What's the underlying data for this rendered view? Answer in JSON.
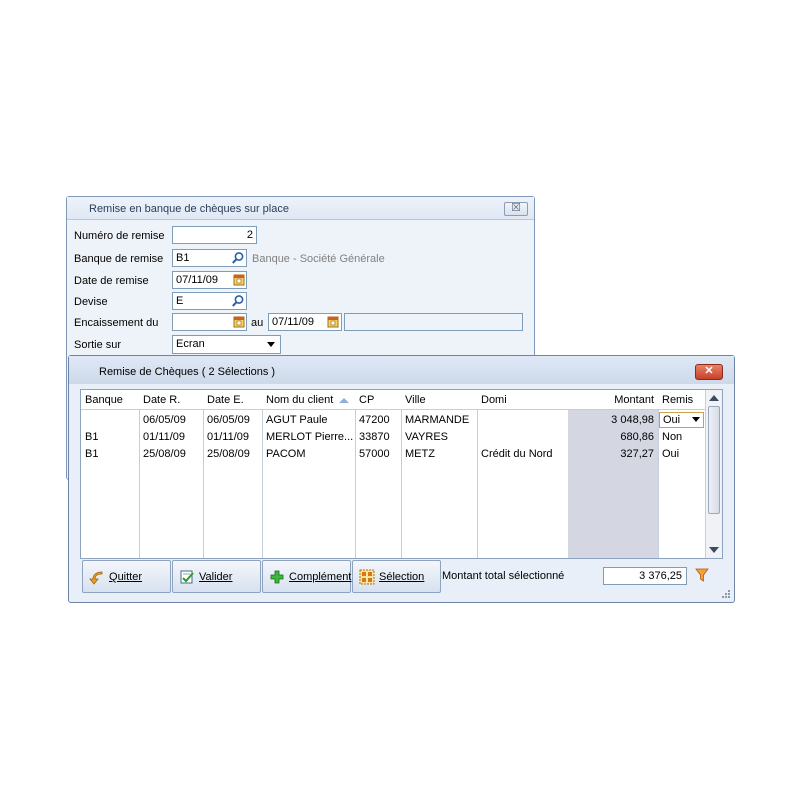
{
  "back_window": {
    "title": "Remise en banque de chèques sur place",
    "close_label": "☒",
    "fields": {
      "numero_label": "Numéro de remise",
      "numero_value": "2",
      "banque_label": "Banque de remise",
      "banque_value": "B1",
      "banque_desc": "Banque - Société Générale",
      "date_label": "Date de remise",
      "date_value": "07/11/09",
      "devise_label": "Devise",
      "devise_value": "E",
      "encaissement_label": "Encaissement du",
      "encaissement_from": "",
      "au_label": "au",
      "encaissement_to": "07/11/09",
      "sortie_label": "Sortie sur",
      "sortie_value": "Ecran"
    }
  },
  "front_window": {
    "title": "Remise de Chèques ( 2 Sélections )",
    "close_label": "✕",
    "columns": [
      "Banque",
      "Date R.",
      "Date E.",
      "Nom du client",
      "CP",
      "Ville",
      "Domi",
      "Montant",
      "Remis"
    ],
    "rows": [
      {
        "banque": "",
        "date_r": "06/05/09",
        "date_e": "06/05/09",
        "nom": "AGUT Paule",
        "cp": "47200",
        "ville": "MARMANDE",
        "domi": "",
        "montant": "3 048,98",
        "remis": "Oui"
      },
      {
        "banque": "B1",
        "date_r": "01/11/09",
        "date_e": "01/11/09",
        "nom": "MERLOT Pierre...",
        "cp": "33870",
        "ville": "VAYRES",
        "domi": "",
        "montant": "680,86",
        "remis": "Non"
      },
      {
        "banque": "B1",
        "date_r": "25/08/09",
        "date_e": "25/08/09",
        "nom": "PACOM",
        "cp": "57000",
        "ville": "METZ",
        "domi": "Crédit du Nord",
        "montant": "327,27",
        "remis": "Oui"
      }
    ],
    "buttons": {
      "quitter_mn": "Q",
      "quitter_rest": "uitter",
      "valider_mn": "V",
      "valider_rest": "alider",
      "complement_mn": "C",
      "complement_rest": "omplément",
      "selection_mn": "S",
      "selection_rest": "élection"
    },
    "total_label": "Montant total sélectionné",
    "total_value": "3 376,25"
  },
  "colors": {
    "accent_border": "#7f9db9",
    "montant_shade": "#d4d7e2",
    "close_red": "#c7402a"
  }
}
